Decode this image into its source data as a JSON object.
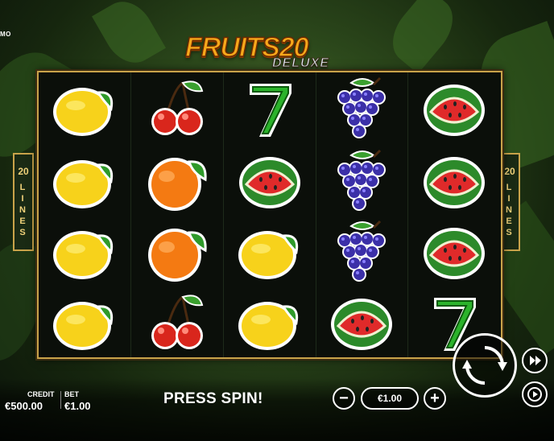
{
  "demo_label": "MO",
  "logo": {
    "line1": "FRUITS20",
    "line2": "DELUXE"
  },
  "lines_left": {
    "number": "20",
    "word": "LINES"
  },
  "lines_right": {
    "number": "20",
    "word": "LINES"
  },
  "reels": [
    [
      "lemon-icon",
      "lemon-icon",
      "lemon-icon",
      "lemon-icon"
    ],
    [
      "cherry-icon",
      "orange-icon",
      "orange-icon",
      "cherry-icon"
    ],
    [
      "seven-icon",
      "watermelon-icon",
      "lemon-icon",
      "lemon-icon"
    ],
    [
      "grapes-icon",
      "grapes-icon",
      "grapes-icon",
      "watermelon-icon"
    ],
    [
      "watermelon-icon",
      "watermelon-icon",
      "watermelon-icon",
      "seven-icon"
    ]
  ],
  "footer": {
    "credit_label": "CREDIT",
    "credit_value": "€500.00",
    "bet_label": "BET",
    "bet_value": "€1.00",
    "message": "PRESS SPIN!",
    "bet_selector": "€1.00",
    "minus": "−",
    "plus": "+"
  },
  "colors": {
    "frame": "#c9a34a",
    "background": "#0b0f0a",
    "lines_text": "#f0d27a"
  }
}
